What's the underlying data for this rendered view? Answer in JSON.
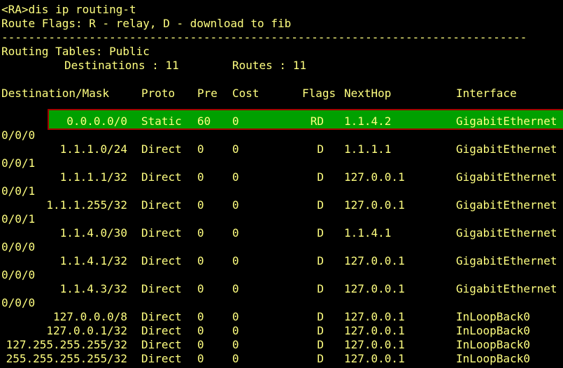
{
  "terminal": {
    "prompt_line": "<RA>dis ip routing-t",
    "flags_line": "Route Flags: R - relay, D - download to fib",
    "separator": "------------------------------------------------------------------------------",
    "tables_line": "Routing Tables: Public",
    "destinations_label": "Destinations : 11",
    "routes_label": "Routes : 11"
  },
  "table": {
    "headers": {
      "destination": "Destination/Mask",
      "proto": "Proto",
      "pre": "Pre",
      "cost": "Cost",
      "flags": "Flags",
      "nexthop": "NextHop",
      "interface": "Interface"
    },
    "rows": [
      {
        "destination": "0.0.0.0/0",
        "proto": "Static",
        "pre": "60",
        "cost": "0",
        "flags": "RD",
        "nexthop": "1.1.4.2",
        "interface": "GigabitEthernet",
        "interface_suffix": "0/0/0",
        "highlighted": true
      },
      {
        "destination": "1.1.1.0/24",
        "proto": "Direct",
        "pre": "0",
        "cost": "0",
        "flags": "D",
        "nexthop": "1.1.1.1",
        "interface": "GigabitEthernet",
        "interface_suffix": "0/0/1"
      },
      {
        "destination": "1.1.1.1/32",
        "proto": "Direct",
        "pre": "0",
        "cost": "0",
        "flags": "D",
        "nexthop": "127.0.0.1",
        "interface": "GigabitEthernet",
        "interface_suffix": "0/0/1"
      },
      {
        "destination": "1.1.1.255/32",
        "proto": "Direct",
        "pre": "0",
        "cost": "0",
        "flags": "D",
        "nexthop": "127.0.0.1",
        "interface": "GigabitEthernet",
        "interface_suffix": "0/0/1"
      },
      {
        "destination": "1.1.4.0/30",
        "proto": "Direct",
        "pre": "0",
        "cost": "0",
        "flags": "D",
        "nexthop": "1.1.4.1",
        "interface": "GigabitEthernet",
        "interface_suffix": "0/0/0"
      },
      {
        "destination": "1.1.4.1/32",
        "proto": "Direct",
        "pre": "0",
        "cost": "0",
        "flags": "D",
        "nexthop": "127.0.0.1",
        "interface": "GigabitEthernet",
        "interface_suffix": "0/0/0"
      },
      {
        "destination": "1.1.4.3/32",
        "proto": "Direct",
        "pre": "0",
        "cost": "0",
        "flags": "D",
        "nexthop": "127.0.0.1",
        "interface": "GigabitEthernet",
        "interface_suffix": "0/0/0"
      },
      {
        "destination": "127.0.0.0/8",
        "proto": "Direct",
        "pre": "0",
        "cost": "0",
        "flags": "D",
        "nexthop": "127.0.0.1",
        "interface": "InLoopBack0"
      },
      {
        "destination": "127.0.0.1/32",
        "proto": "Direct",
        "pre": "0",
        "cost": "0",
        "flags": "D",
        "nexthop": "127.0.0.1",
        "interface": "InLoopBack0"
      },
      {
        "destination": "127.255.255.255/32",
        "proto": "Direct",
        "pre": "0",
        "cost": "0",
        "flags": "D",
        "nexthop": "127.0.0.1",
        "interface": "InLoopBack0"
      },
      {
        "destination": "255.255.255.255/32",
        "proto": "Direct",
        "pre": "0",
        "cost": "0",
        "flags": "D",
        "nexthop": "127.0.0.1",
        "interface": "InLoopBack0"
      }
    ]
  },
  "colors": {
    "background": "#000000",
    "text": "#ffff80",
    "highlight_fill": "#00a000",
    "highlight_border": "#a00000"
  }
}
